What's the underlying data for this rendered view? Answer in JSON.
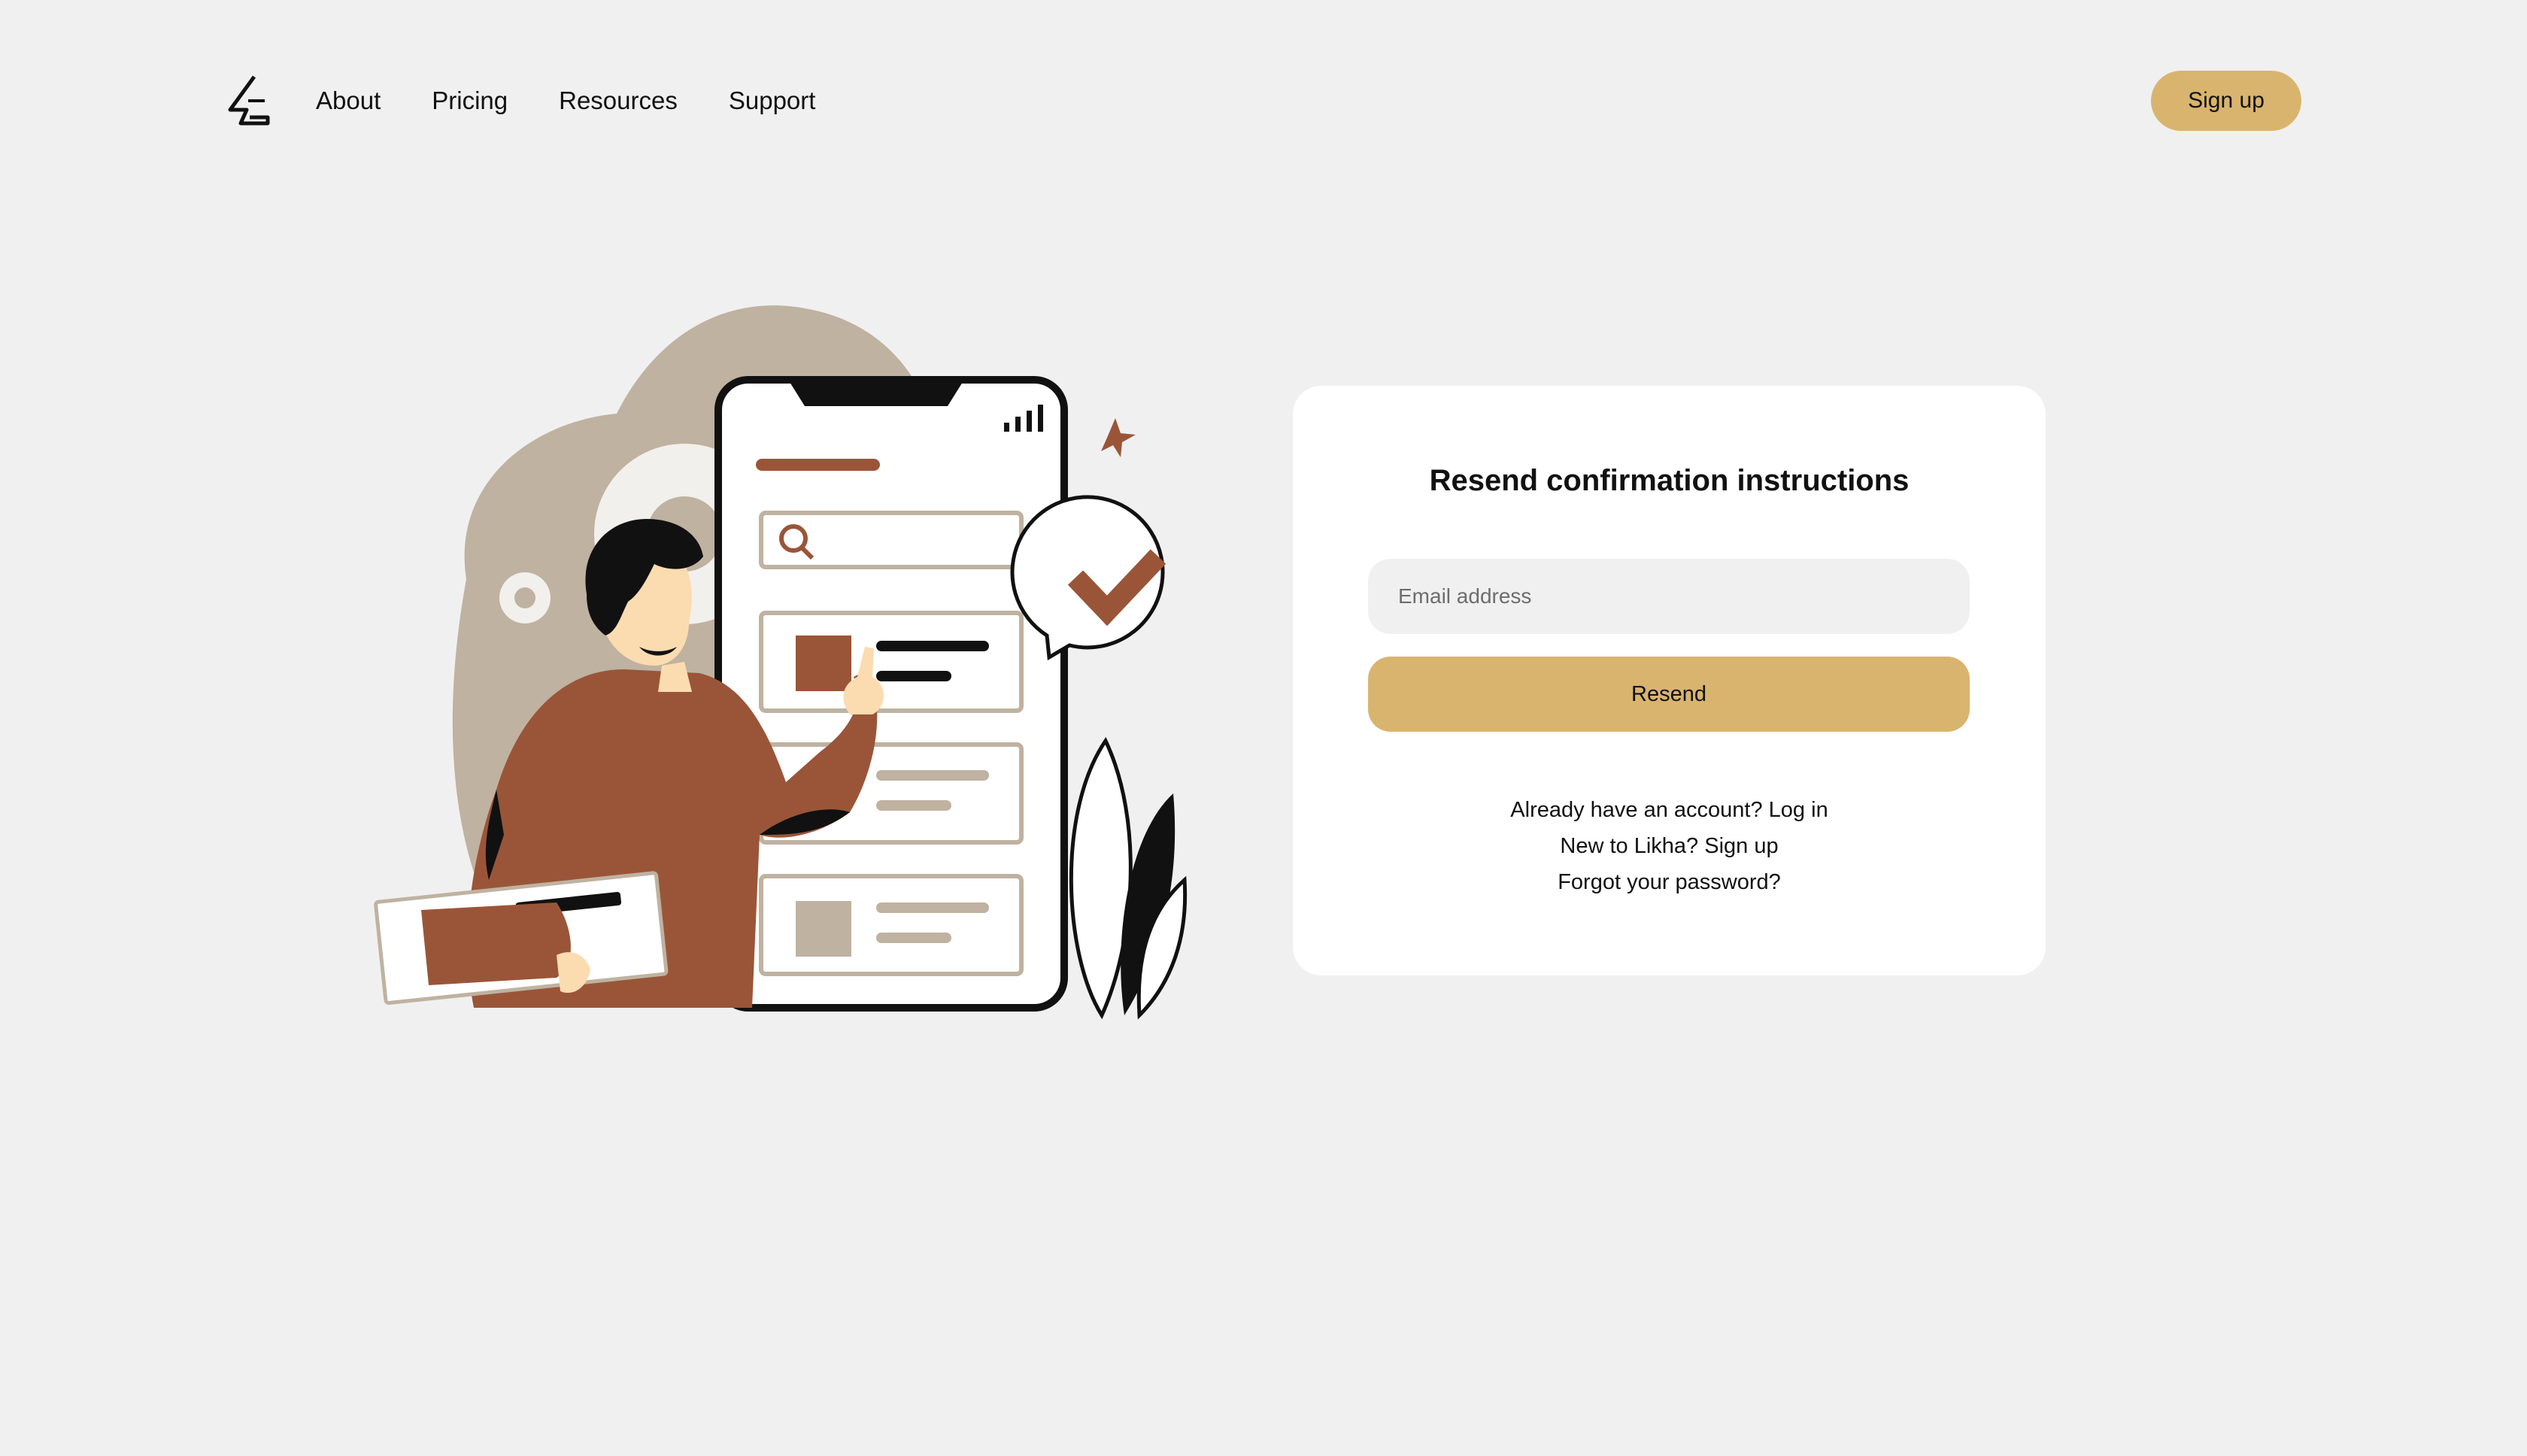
{
  "nav": {
    "logo_icon": "likha-logo-icon",
    "links": [
      "About",
      "Pricing",
      "Resources",
      "Support"
    ],
    "signup_label": "Sign up"
  },
  "illustration": {
    "icon": "person-phone-checklist-illustration"
  },
  "form": {
    "title": "Resend confirmation instructions",
    "email_placeholder": "Email address",
    "email_value": "",
    "submit_label": "Resend",
    "links": [
      "Already have an account? Log in",
      "New to Likha? Sign up",
      "Forgot your password?"
    ]
  },
  "colors": {
    "background": "#f0f0f0",
    "accent": "#d9b46e",
    "brown": "#9a5538",
    "beige": "#bfb2a1",
    "card": "#ffffff"
  }
}
